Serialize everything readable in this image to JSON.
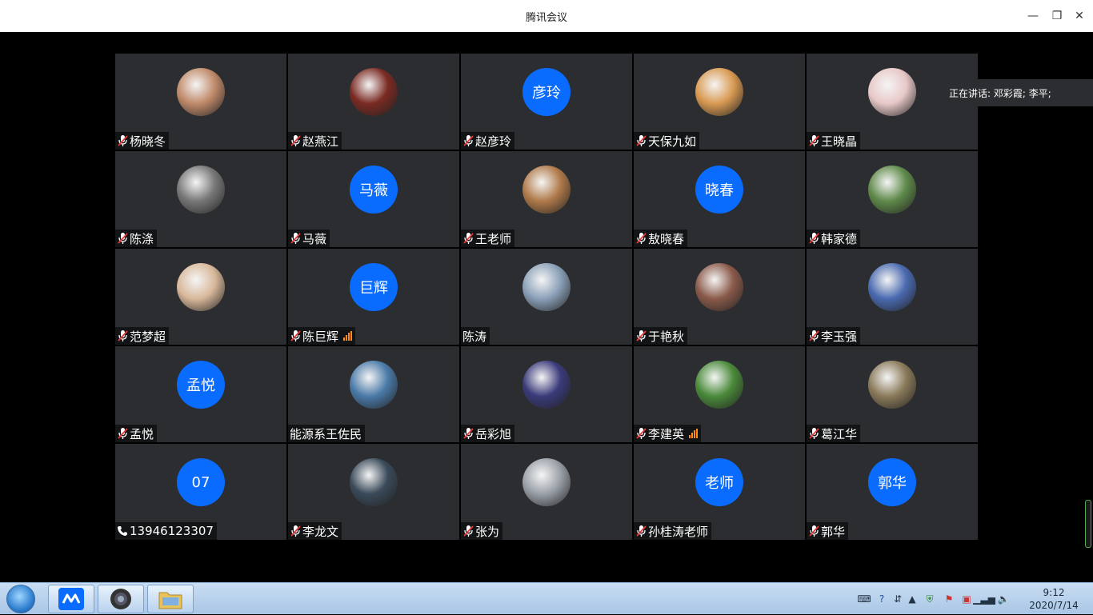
{
  "window": {
    "title": "腾讯会议",
    "minimize": "—",
    "restore": "❐",
    "close": "✕"
  },
  "speaking": {
    "text": "正在讲话: 邓彩霞; 李平;"
  },
  "participants": [
    {
      "name": "杨晓冬",
      "avatar": "photo",
      "muted": true,
      "color": "#c08a6a"
    },
    {
      "name": "赵燕江",
      "avatar": "photo",
      "muted": true,
      "color": "#7a2a22"
    },
    {
      "name": "赵彦玲",
      "avatar_text": "彦玲",
      "muted": true
    },
    {
      "name": "天保九如",
      "avatar": "photo",
      "muted": true,
      "color": "#d99a52"
    },
    {
      "name": "王晓晶",
      "avatar": "photo",
      "muted": true,
      "color": "#e8c8c8"
    },
    {
      "name": "陈涤",
      "avatar": "photo",
      "muted": true,
      "color": "#777777"
    },
    {
      "name": "马薇",
      "avatar_text": "马薇",
      "muted": true
    },
    {
      "name": "王老师",
      "avatar": "photo",
      "muted": true,
      "color": "#b07a4a"
    },
    {
      "name": "敖晓春",
      "avatar_text": "晓春",
      "muted": true
    },
    {
      "name": "韩家德",
      "avatar": "photo",
      "muted": true,
      "color": "#5f8a4a"
    },
    {
      "name": "范梦超",
      "avatar": "photo",
      "muted": true,
      "color": "#d8b89a"
    },
    {
      "name": "陈巨辉",
      "avatar_text": "巨辉",
      "muted": true,
      "signal": true
    },
    {
      "name": "陈涛",
      "avatar": "photo",
      "muted": false,
      "color": "#8aa0b8"
    },
    {
      "name": "于艳秋",
      "avatar": "photo",
      "muted": true,
      "color": "#8a5a4a"
    },
    {
      "name": "李玉强",
      "avatar": "photo",
      "muted": true,
      "color": "#4a6ab0"
    },
    {
      "name": "孟悦",
      "avatar_text": "孟悦",
      "muted": true
    },
    {
      "name": "能源系王佐民",
      "avatar": "photo",
      "muted": false,
      "color": "#4a7aa8"
    },
    {
      "name": "岳彩旭",
      "avatar": "photo",
      "muted": true,
      "color": "#3a3a7a"
    },
    {
      "name": "李建英",
      "avatar": "photo",
      "muted": true,
      "signal": true,
      "color": "#4a8a3a"
    },
    {
      "name": "葛江华",
      "avatar": "photo",
      "muted": true,
      "color": "#8a7a5a"
    },
    {
      "name": "13946123307",
      "avatar_text": "07",
      "phone": true
    },
    {
      "name": "李龙文",
      "avatar": "photo",
      "muted": true,
      "color": "#3a4a5a"
    },
    {
      "name": "张为",
      "avatar": "photo",
      "muted": true,
      "color": "#9aa0a8"
    },
    {
      "name": "孙桂涛老师",
      "avatar_text": "老师",
      "muted": true
    },
    {
      "name": "郭华",
      "avatar_text": "郭华",
      "muted": true
    }
  ],
  "taskbar": {
    "apps": [
      "tencent-meeting",
      "camera",
      "file-explorer"
    ],
    "clock_time": "9:12",
    "clock_date": "2020/7/14"
  },
  "colors": {
    "tile_bg": "#2c2d30",
    "avatar_blue": "#0a6cff",
    "mic_red": "#e23b3b"
  }
}
